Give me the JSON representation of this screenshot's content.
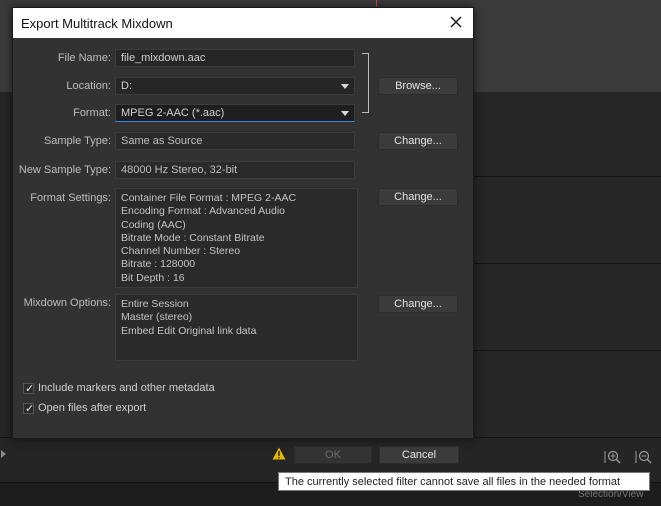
{
  "dialog": {
    "title": "Export Multitrack Mixdown",
    "file_name_label": "File Name:",
    "file_name_value": "file_mixdown.aac",
    "location_label": "Location:",
    "location_value": "D:",
    "format_label": "Format:",
    "format_value": "MPEG 2-AAC (*.aac)",
    "browse_label": "Browse...",
    "sample_type_label": "Sample Type:",
    "sample_type_value": "Same as Source",
    "sample_change_label": "Change...",
    "new_sample_type_label": "New Sample Type:",
    "new_sample_type_value": "48000 Hz Stereo, 32-bit",
    "format_settings_label": "Format Settings:",
    "format_settings_lines": [
      "Container File Format : MPEG 2-AAC",
      "Encoding Format : Advanced Audio",
      "Coding (AAC)",
      "Bitrate Mode : Constant Bitrate",
      "Channel Number : Stereo",
      "Bitrate : 128000",
      "Bit Depth : 16"
    ],
    "format_change_label": "Change...",
    "mixdown_options_label": "Mixdown Options:",
    "mixdown_options_lines": [
      "Entire Session",
      "Master (stereo)",
      "Embed Edit Original link data"
    ],
    "mixdown_change_label": "Change...",
    "include_markers_label": "Include markers and other metadata",
    "include_markers_checked": true,
    "open_files_label": "Open files after export",
    "open_files_checked": true,
    "ok_label": "OK",
    "cancel_label": "Cancel"
  },
  "tooltip": {
    "text": "The currently selected filter cannot save all files in the needed format"
  },
  "background": {
    "status_text": "Selection/View"
  },
  "colors": {
    "dialog_bg": "#323232",
    "field_bg": "#262626",
    "accent": "#3a8ee6",
    "warning": "#e8b400"
  },
  "icons": [
    "close-icon",
    "dropdown-arrow-icon",
    "checkmark-icon",
    "warning-icon",
    "zoom-in-icon",
    "zoom-out-icon",
    "play-icon"
  ]
}
